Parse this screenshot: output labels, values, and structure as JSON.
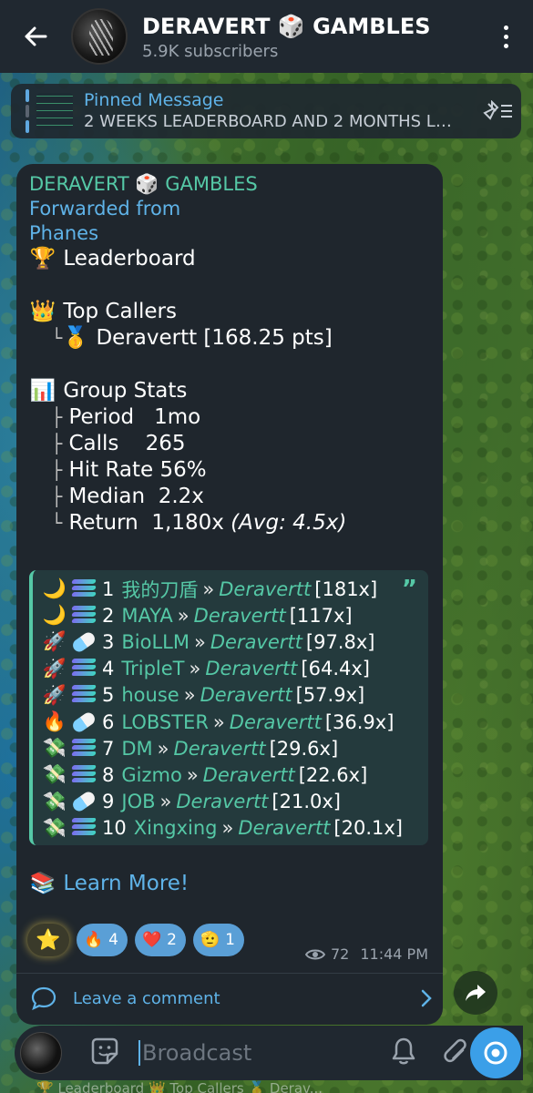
{
  "header": {
    "title": "DERAVERT 🎲 GAMBLES",
    "subtitle": "5.9K subscribers"
  },
  "pinned": {
    "label": "Pinned Message",
    "text": "2 WEEKS LEADERBOARD AND 2 MONTHS LE..."
  },
  "message": {
    "sender": "DERAVERT 🎲 GAMBLES",
    "forwarded_line1": "Forwarded from",
    "forwarded_line2": "Phanes",
    "leaderboard_title": "Leaderboard",
    "top_callers_title": "Top Callers",
    "top_caller": "Deravertt [168.25 pts]",
    "group_stats_title": "Group Stats",
    "stats": [
      {
        "label": "Period",
        "value": "1mo"
      },
      {
        "label": "Calls",
        "value": "265"
      },
      {
        "label": "Hit Rate",
        "value": "56%"
      },
      {
        "label": "Median",
        "value": "2.2x"
      },
      {
        "label": "Return",
        "value": "1,180x",
        "extra": "(Avg: 4.5x)"
      }
    ],
    "calls": [
      {
        "icon": "🌙",
        "bars": "stack",
        "rank": "1",
        "token": "我的刀盾",
        "caller": "Deravertt",
        "mult": "[181x]"
      },
      {
        "icon": "🌙",
        "bars": "stack",
        "rank": "2",
        "token": "MAYA",
        "caller": "Deravertt",
        "mult": "[117x]"
      },
      {
        "icon": "🚀",
        "bars": "pill",
        "rank": "3",
        "token": "BioLLM",
        "caller": "Deravertt",
        "mult": "[97.8x]"
      },
      {
        "icon": "🚀",
        "bars": "stack",
        "rank": "4",
        "token": "TripleT",
        "caller": "Deravertt",
        "mult": "[64.4x]"
      },
      {
        "icon": "🚀",
        "bars": "stack",
        "rank": "5",
        "token": "house",
        "caller": "Deravertt",
        "mult": "[57.9x]"
      },
      {
        "icon": "🔥",
        "bars": "pill",
        "rank": "6",
        "token": "LOBSTER",
        "caller": "Deravertt",
        "mult": "[36.9x]"
      },
      {
        "icon": "💸",
        "bars": "stack",
        "rank": "7",
        "token": "DM",
        "caller": "Deravertt",
        "mult": "[29.6x]"
      },
      {
        "icon": "💸",
        "bars": "stack",
        "rank": "8",
        "token": "Gizmo",
        "caller": "Deravertt",
        "mult": "[22.6x]"
      },
      {
        "icon": "💸",
        "bars": "pill",
        "rank": "9",
        "token": "JOB",
        "caller": "Deravertt",
        "mult": "[21.0x]"
      },
      {
        "icon": "💸",
        "bars": "stack",
        "rank": "10",
        "token": "Xingxing",
        "caller": "Deravertt",
        "mult": "[20.1x]"
      }
    ],
    "learn_more": "Learn More!",
    "reactions": [
      {
        "emoji": "🔥",
        "count": "4"
      },
      {
        "emoji": "❤️",
        "count": "2"
      },
      {
        "emoji": "🫡",
        "count": "1"
      }
    ],
    "star_reaction": "⭐",
    "views": "72",
    "time": "11:44 PM",
    "comment_label": "Leave a comment"
  },
  "input": {
    "placeholder": "Broadcast"
  },
  "bottom_strip": "🏆 Leaderboard 👑 Top Callers 🥇 Derav..."
}
